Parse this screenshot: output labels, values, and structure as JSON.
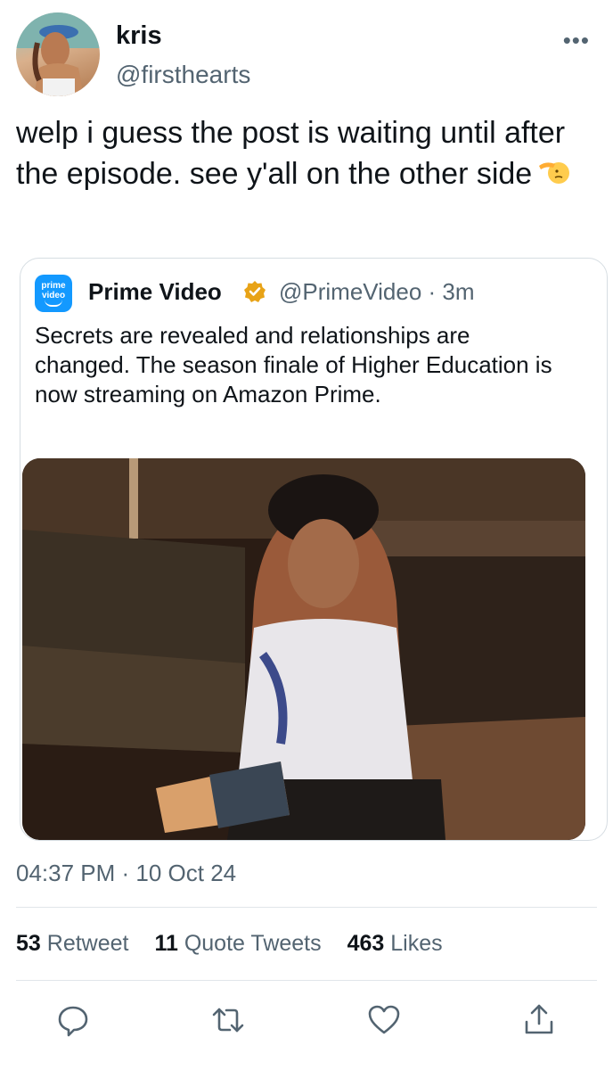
{
  "author": {
    "display_name": "kris",
    "handle": "@firsthearts",
    "more_label": "•••"
  },
  "tweet": {
    "text": "welp i guess the post is waiting until after the episode. see y'all on the other side"
  },
  "quoted": {
    "logo_line1": "prime",
    "logo_line2": "video",
    "display_name": "Prime Video",
    "meta": "@PrimeVideo · 3m",
    "text": "Secrets are revealed and relationships are changed. The season finale of Higher Education is now streaming on Amazon Prime."
  },
  "timestamp": "04:37 PM · 10 Oct 24",
  "stats": {
    "retweets_count": "53",
    "retweets_label": "Retweet",
    "quotes_count": "11",
    "quotes_label": "Quote Tweets",
    "likes_count": "463",
    "likes_label": "Likes"
  },
  "colors": {
    "accent": "#1d9bf0",
    "verified": "#e8a317",
    "secondary_text": "#536471"
  },
  "icons": [
    "reply-icon",
    "retweet-icon",
    "like-icon",
    "share-icon",
    "verified-badge-icon",
    "saluting-face-emoji"
  ]
}
